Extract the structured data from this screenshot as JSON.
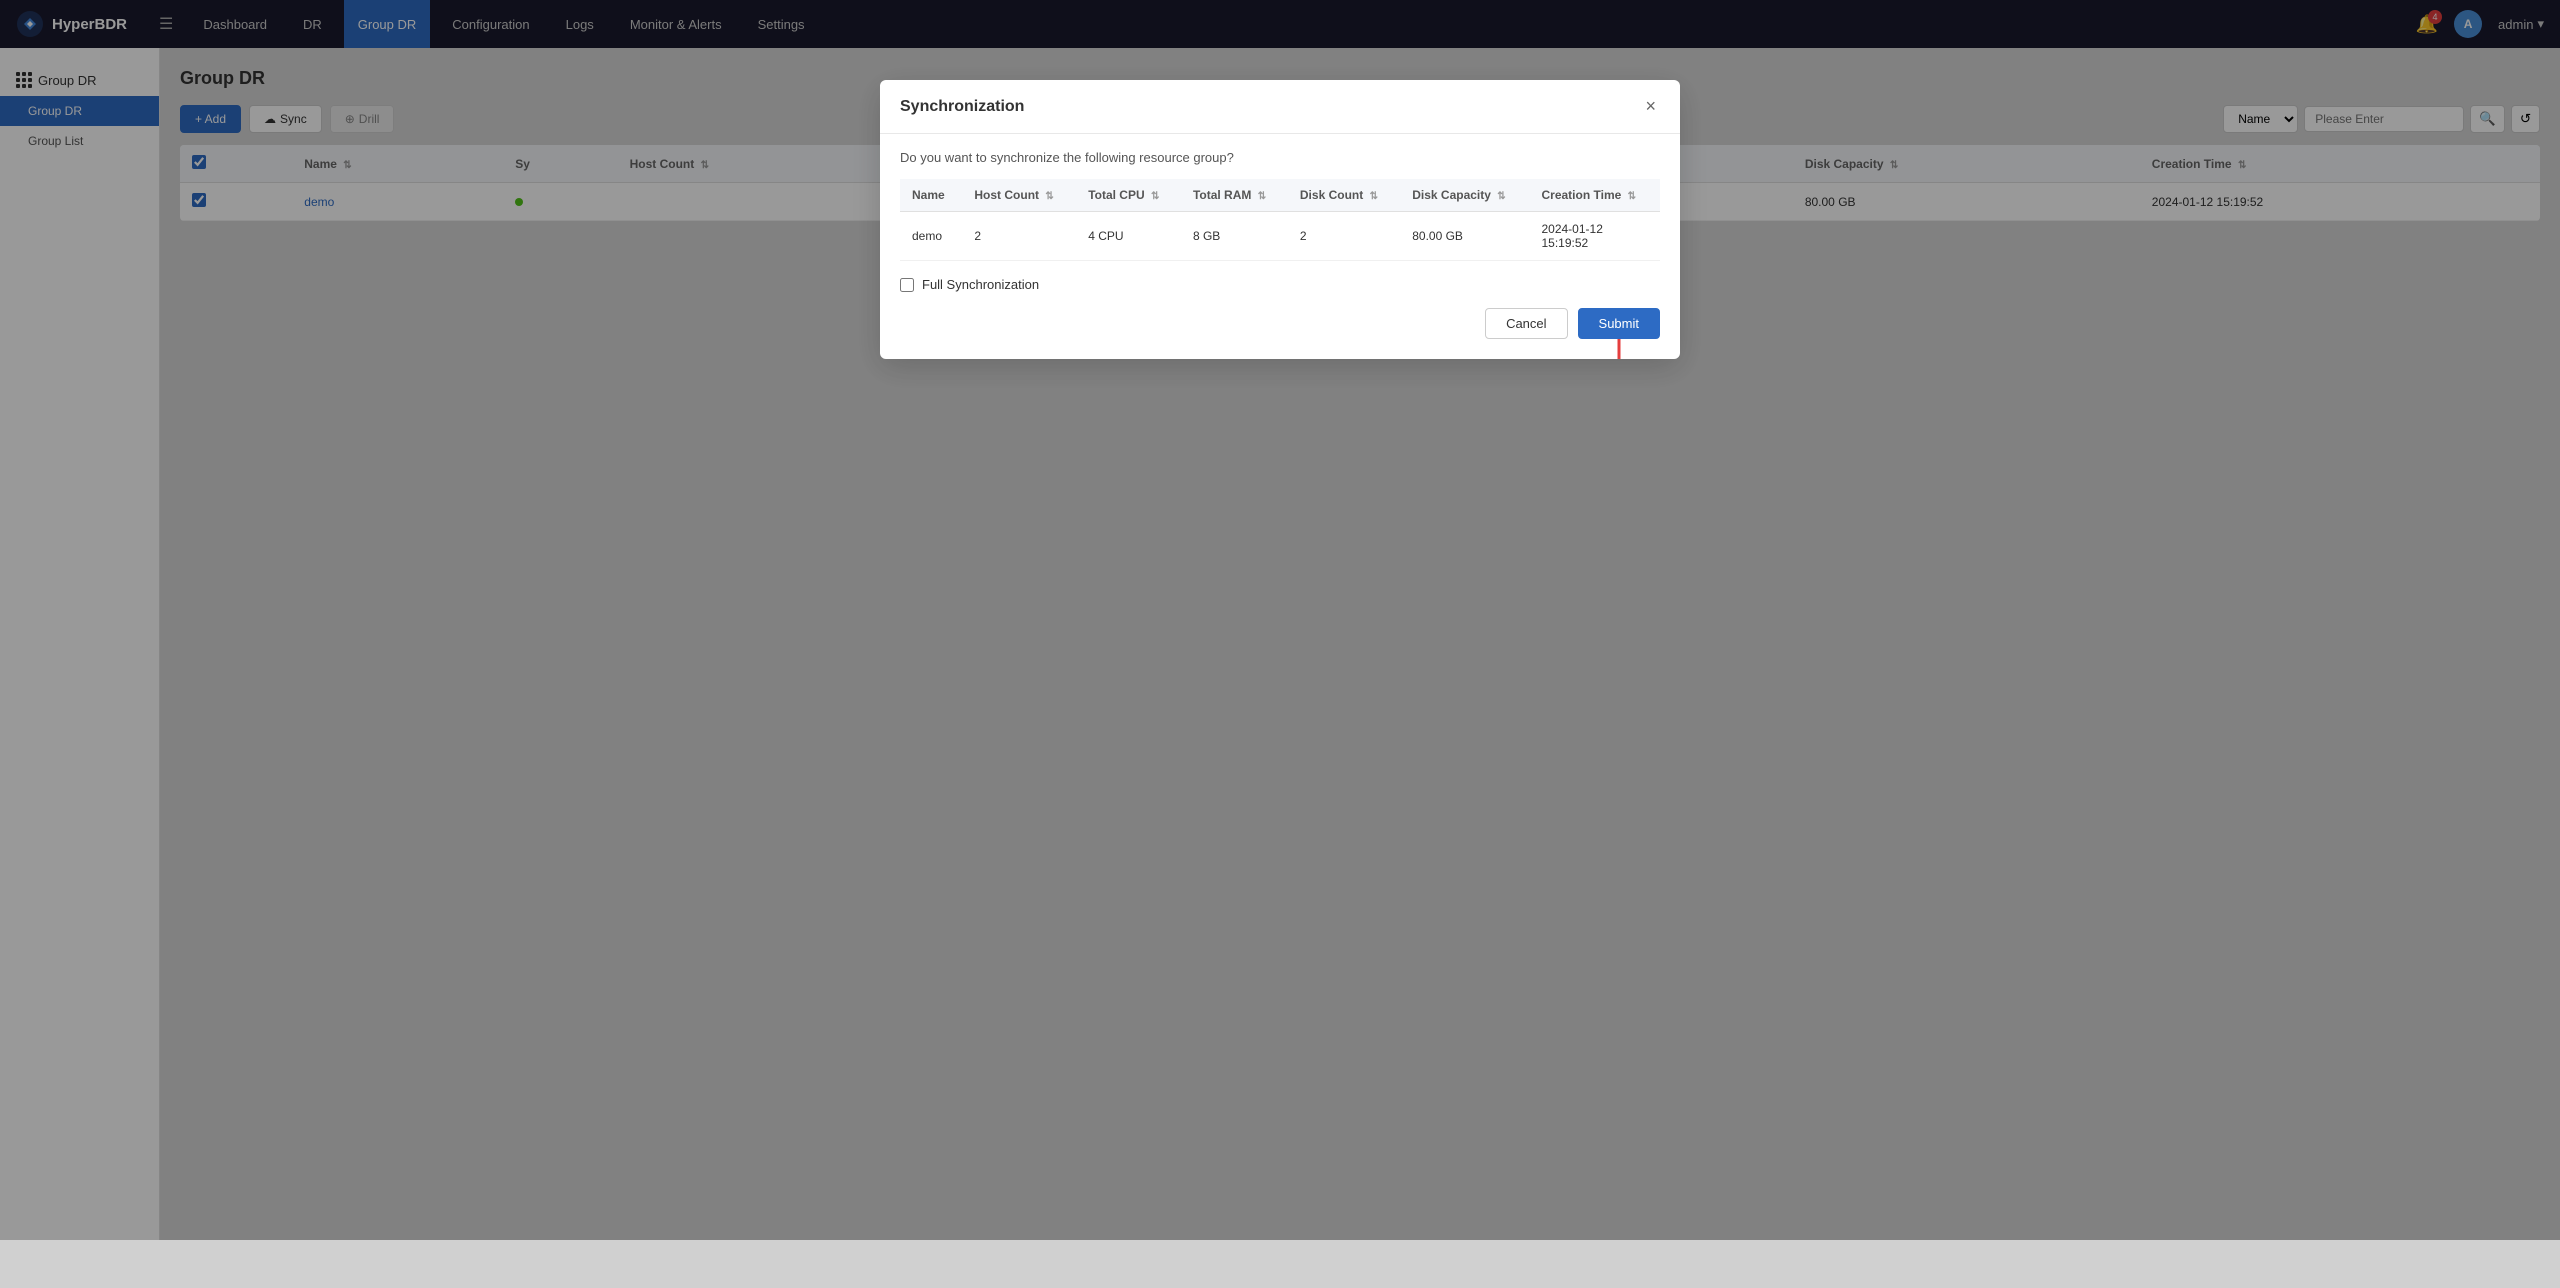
{
  "app": {
    "logo_text": "HyperBDR",
    "nav_items": [
      {
        "label": "Dashboard",
        "active": false
      },
      {
        "label": "DR",
        "active": false
      },
      {
        "label": "Group DR",
        "active": true
      },
      {
        "label": "Configuration",
        "active": false
      },
      {
        "label": "Logs",
        "active": false
      },
      {
        "label": "Monitor & Alerts",
        "active": false
      },
      {
        "label": "Settings",
        "active": false
      }
    ],
    "bell_badge": "4",
    "user_label": "admin"
  },
  "sidebar": {
    "group_label": "Group DR",
    "items": [
      {
        "label": "Group DR",
        "active": true
      },
      {
        "label": "Group List",
        "active": false
      }
    ]
  },
  "page": {
    "title": "Group DR",
    "breadcrumb": "Group DR"
  },
  "toolbar": {
    "add_label": "+ Add",
    "sync_label": "Sync",
    "drill_label": "Drill",
    "search_placeholder": "Please Enter",
    "search_select_label": "Name",
    "search_select_options": [
      "Name"
    ]
  },
  "table": {
    "columns": [
      "Name",
      "Sy",
      "Host Count",
      "Total CPU",
      "Total RAM",
      "Disk Count",
      "Disk Capacity",
      "Creation Time"
    ],
    "rows": [
      {
        "checked": true,
        "name": "demo",
        "status": "green",
        "host_count": "",
        "total_cpu": "",
        "total_ram": "",
        "disk_count": "2",
        "disk_capacity": "80.00 GB",
        "creation_time": "2024-01-12 15:19:52"
      }
    ]
  },
  "modal": {
    "title": "Synchronization",
    "close_label": "×",
    "description": "Do you want to synchronize the following resource group?",
    "table": {
      "columns": [
        "Name",
        "Host Count",
        "Total CPU",
        "Total RAM",
        "Disk Count",
        "Disk Capacity",
        "Creation Time"
      ],
      "rows": [
        {
          "name": "demo",
          "host_count": "2",
          "total_cpu": "4 CPU",
          "total_ram": "8 GB",
          "disk_count": "2",
          "disk_capacity": "80.00 GB",
          "creation_time": "2024-01-12\n15:19:52"
        }
      ]
    },
    "full_sync_label": "Full Synchronization",
    "cancel_label": "Cancel",
    "submit_label": "Submit"
  }
}
